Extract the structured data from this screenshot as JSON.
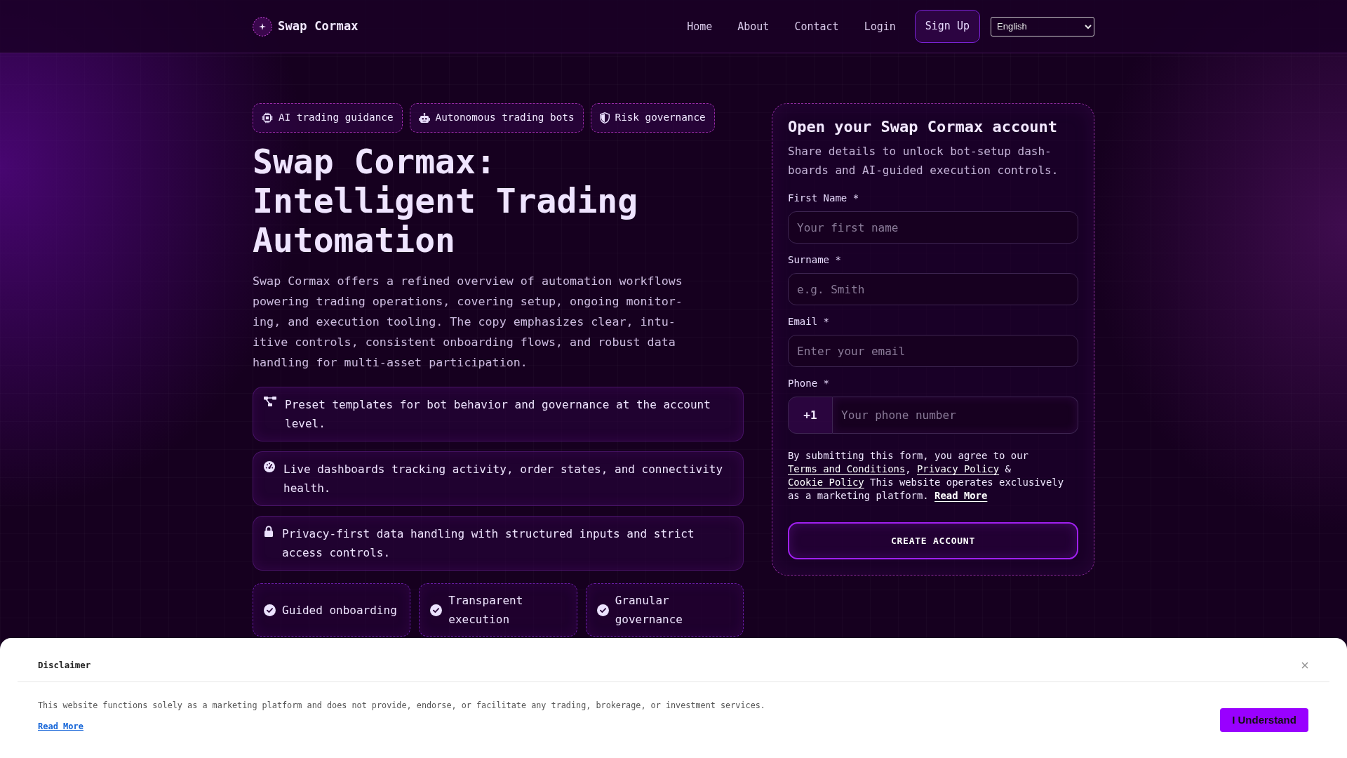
{
  "nav": {
    "brand": "Swap Cormax",
    "links": [
      {
        "label": "Home"
      },
      {
        "label": "About"
      },
      {
        "label": "Contact"
      },
      {
        "label": "Login"
      }
    ],
    "cta": "Sign Up",
    "language": "English"
  },
  "hero": {
    "chips": [
      {
        "label": "AI trading guidance"
      },
      {
        "label": "Autonomous trading bots"
      },
      {
        "label": "Risk governance"
      }
    ],
    "title": "Swap Cormax: Intelligent Trading Automation",
    "intro": "Swap Cormax offers a refined overview of automation workflows powering trading operations, covering setup, ongoing monitor-ing, and execution tooling. The copy emphasizes clear, intu-itive controls, consistent onboarding flows, and robust data handling for multi-asset participation.",
    "features": [
      {
        "text": "Preset templates for bot behavior and governance at the account level."
      },
      {
        "text": "Live dashboards tracking activity, order states, and connectivity health."
      },
      {
        "text": "Privacy-first data handling with structured inputs and strict access controls."
      }
    ],
    "highlights": [
      {
        "label": "Guided onboarding"
      },
      {
        "label": "Transparent execution"
      },
      {
        "label": "Granular governance"
      }
    ]
  },
  "form": {
    "title": "Open your Swap Cormax account",
    "subtitle": "Share details to unlock bot-setup dash-boards and AI-guided execution controls.",
    "fields": [
      {
        "kind": "text",
        "label": "First Name *",
        "placeholder": "Your first name"
      },
      {
        "kind": "text",
        "label": "Surname *",
        "placeholder": "e.g. Smith"
      },
      {
        "kind": "email",
        "label": "Email *",
        "placeholder": "Enter your email"
      },
      {
        "kind": "phone",
        "label": "Phone *",
        "prefix": "+1",
        "placeholder": "Your phone number"
      }
    ],
    "consent": [
      {
        "kind": "text",
        "text": "By submitting this form, you agree to our "
      },
      {
        "kind": "link",
        "text": "Terms and Conditions",
        "bold": false
      },
      {
        "kind": "text",
        "text": ", "
      },
      {
        "kind": "link",
        "text": "Privacy Policy",
        "bold": false
      },
      {
        "kind": "text",
        "text": " & "
      },
      {
        "kind": "link",
        "text": "Cookie Policy",
        "bold": false
      },
      {
        "kind": "text",
        "text": " This website operates exclusively as a marketing platform. "
      },
      {
        "kind": "link",
        "text": "Read More",
        "bold": true
      }
    ],
    "submit": "CREATE ACCOUNT"
  },
  "disclaimer": {
    "title": "Disclaimer",
    "text": "This website functions solely as a marketing platform and does not provide, endorse, or facilitate any trading, brokerage, or investment services.",
    "link": "Read More",
    "button": "I Understand"
  }
}
